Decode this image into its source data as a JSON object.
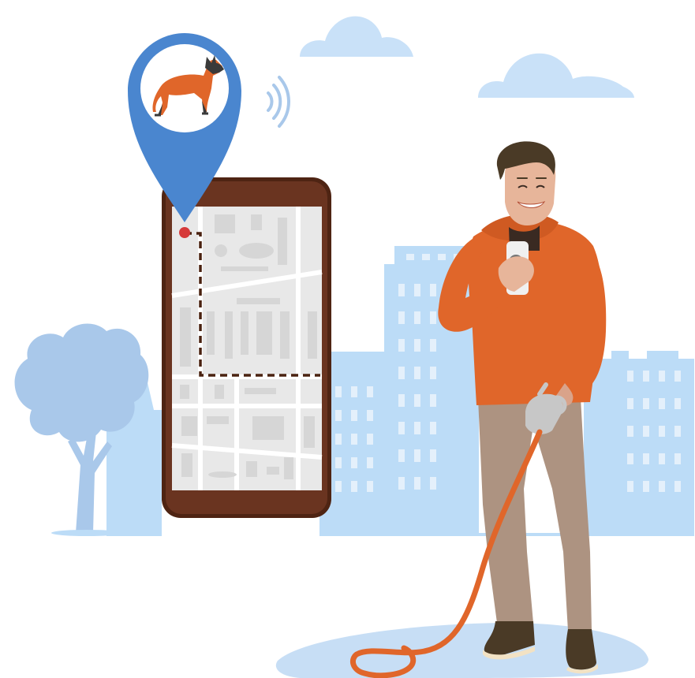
{
  "illustration": {
    "colors": {
      "sky_light": "#c9e1f8",
      "city": "#bcdcf7",
      "tree": "#a9c8ea",
      "pin_blue": "#4a86cf",
      "phone_frame": "#5a2c17",
      "map_bg": "#e8e8e8",
      "route_dash": "#4a2210",
      "location_dot": "#d63a3a",
      "sweater": "#e0662a",
      "pants": "#ad9381",
      "shoes": "#4a3a26",
      "leash": "#e0662a",
      "ground": "#c7def5",
      "dog": "#e0662a"
    },
    "icons": [
      "cloud-icon",
      "location-pin-icon",
      "dog-icon",
      "signal-waves-icon",
      "tree-icon"
    ]
  }
}
